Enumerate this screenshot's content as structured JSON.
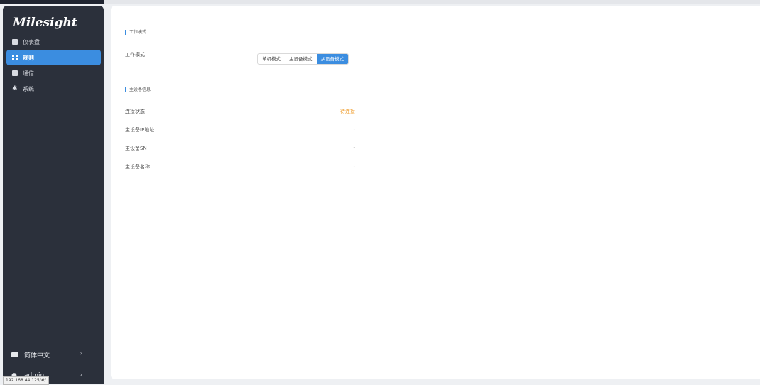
{
  "brand": "Milesight",
  "nav": [
    {
      "label": "仪表盘",
      "icon": "dashboard-icon"
    },
    {
      "label": "规则",
      "icon": "rules-grid-icon",
      "active": true
    },
    {
      "label": "通信",
      "icon": "communication-icon"
    },
    {
      "label": "系统",
      "icon": "gear-icon"
    }
  ],
  "sidebar_bottom": {
    "language_label": "简体中文",
    "user_label": "admin",
    "chevron": "›"
  },
  "status_url": "192.168.44.125/#/",
  "work_mode": {
    "section_title": "工作模式",
    "row_label": "工作模式",
    "options": [
      "单机模式",
      "主设备模式",
      "从设备模式"
    ],
    "selected": "从设备模式"
  },
  "master_info": {
    "section_title": "主设备信息",
    "rows": [
      {
        "label": "连接状态",
        "value": "待连接"
      },
      {
        "label": "主设备IP地址",
        "value": "-"
      },
      {
        "label": "主设备SN",
        "value": "-"
      },
      {
        "label": "主设备名称",
        "value": "-"
      }
    ]
  },
  "colors": {
    "accent": "#3b8de0",
    "sidebar_bg": "#2b303b",
    "status_pending": "#f0a33a"
  }
}
